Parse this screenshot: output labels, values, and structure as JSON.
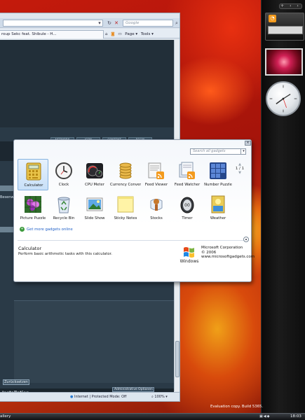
{
  "ie": {
    "search_placeholder": "Google",
    "tab_title": "roup Sekc feat. Shibule - H...",
    "tools": [
      "Page ▾",
      "Tools ▾"
    ],
    "nav_buttons": [
      "NETWORK",
      "ICON",
      "CONTENT",
      "BEGIN"
    ],
    "left_label": "Besenw",
    "reset_button": "Zurücksetzen",
    "install_label": "Installation",
    "admin_options": "Administrative Optionen",
    "status_zone": "Internet | Protected Mode: Off",
    "zoom": "100%"
  },
  "gallery": {
    "close": "×",
    "search_placeholder": "Search all gadgets",
    "page_indicator": "1 / 1",
    "gadgets": [
      {
        "label": "Calculator",
        "icon": "calculator-icon",
        "selected": true
      },
      {
        "label": "Clock",
        "icon": "clock-icon"
      },
      {
        "label": "CPU Meter",
        "icon": "cpu-meter-icon"
      },
      {
        "label": "Currency Convers...",
        "icon": "currency-icon"
      },
      {
        "label": "Feed Viewer",
        "icon": "feed-viewer-icon"
      },
      {
        "label": "Feed Watcher",
        "icon": "feed-watcher-icon"
      },
      {
        "label": "Number Puzzle",
        "icon": "number-puzzle-icon"
      },
      {
        "label": "Picture Puzzle",
        "icon": "picture-puzzle-icon"
      },
      {
        "label": "Recycle Bin",
        "icon": "recycle-bin-icon"
      },
      {
        "label": "Slide Show",
        "icon": "slide-show-icon"
      },
      {
        "label": "Sticky Notes",
        "icon": "sticky-notes-icon"
      },
      {
        "label": "Stocks",
        "icon": "stocks-icon"
      },
      {
        "label": "Timer",
        "icon": "timer-icon"
      },
      {
        "label": "Weather",
        "icon": "weather-icon"
      }
    ],
    "get_more": "Get more gadgets online",
    "details": {
      "title": "Calculator",
      "description": "Perform basic arithmetic tasks with this calculator.",
      "publisher": "Microsoft Corporation",
      "year": "© 2006",
      "url": "www.microsoftgadgets.com",
      "logo_text": "Windows"
    }
  },
  "sidebar": {
    "top_controls": "+ ‹ ›"
  },
  "taskbar": {
    "gallery_label": "allery",
    "time": "18:03"
  },
  "desktop": {
    "evaluation_line1": "Evaluation copy. Build 5365.",
    "evaluation_line2": ""
  },
  "colors": {
    "accent": "#1e5fc7",
    "selection": "#c8e0f8"
  }
}
